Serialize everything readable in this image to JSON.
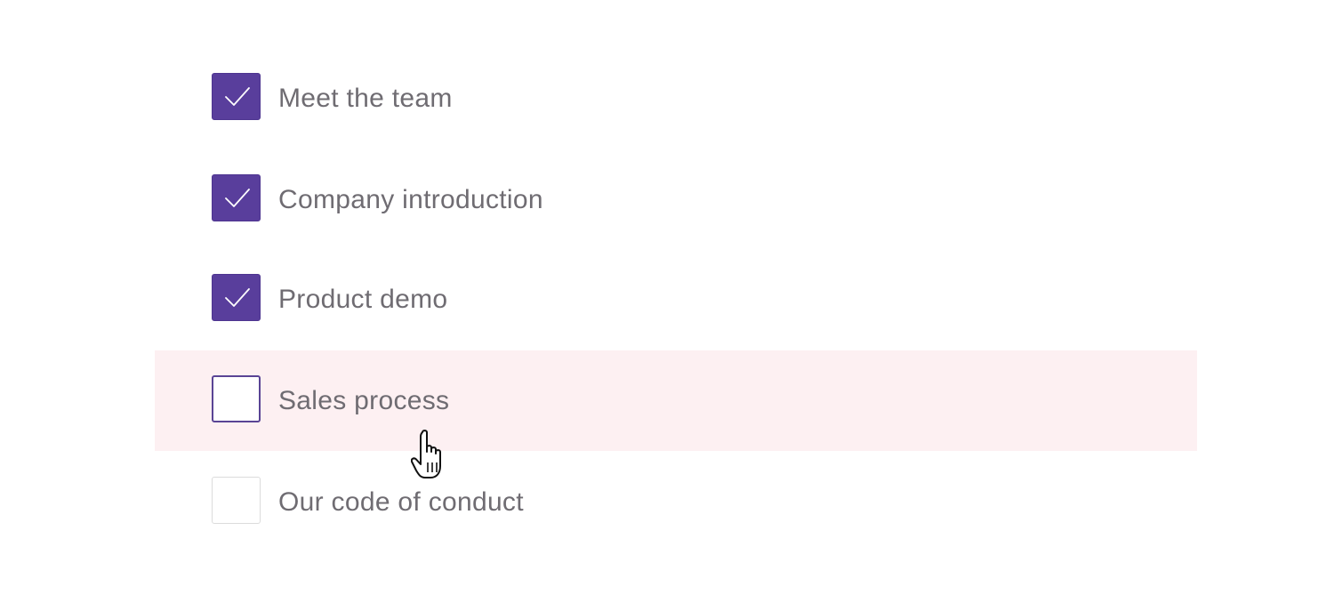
{
  "checklist": {
    "items": [
      {
        "label": "Meet the team",
        "checked": true
      },
      {
        "label": "Company introduction",
        "checked": true
      },
      {
        "label": "Product demo",
        "checked": true
      },
      {
        "label": "Sales process",
        "checked": false,
        "hovered": true
      },
      {
        "label": "Our code of conduct",
        "checked": false
      }
    ]
  },
  "colors": {
    "accent": "#593e9c",
    "hover_background": "#fdf0f2",
    "label_text": "#6f6c72",
    "unchecked_border": "#dcdcdc"
  },
  "icons": {
    "check": "checkmark-icon",
    "cursor": "hand-pointer-cursor-icon"
  }
}
